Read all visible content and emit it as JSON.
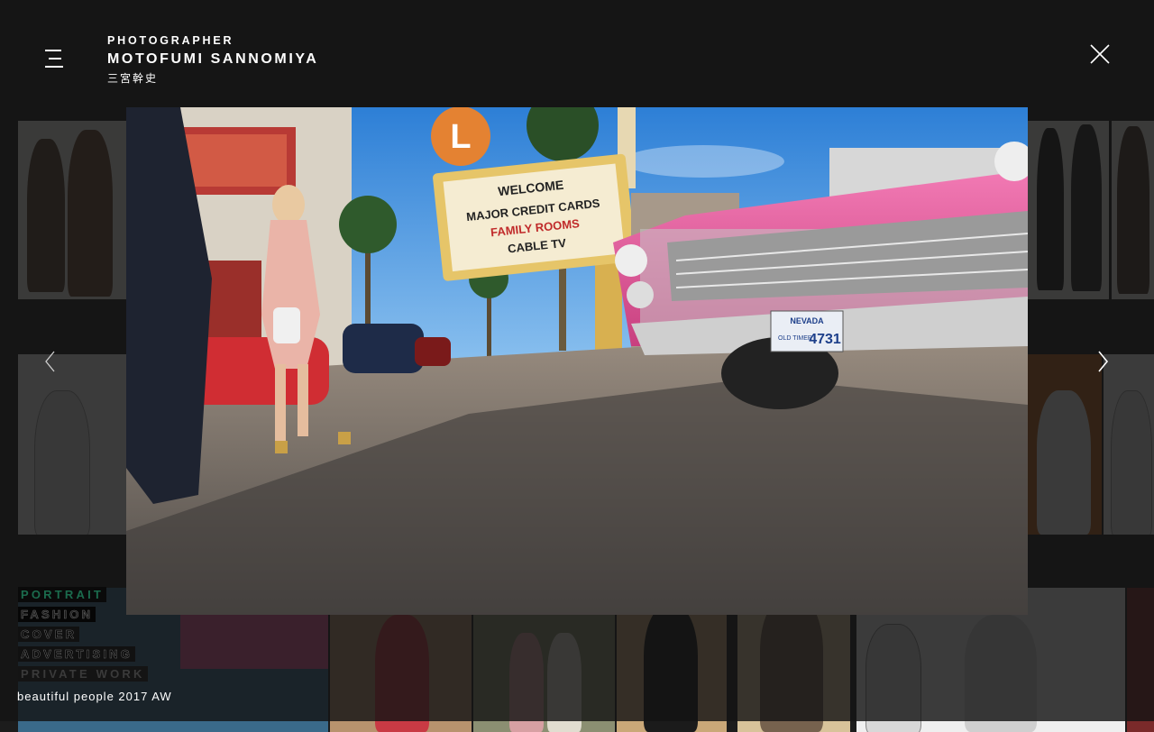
{
  "header": {
    "logo_line1": "PHOTOGRAPHER",
    "logo_line2": "MOTOFUMI SANNOMIYA",
    "logo_line3": "三宮幹史"
  },
  "icons": {
    "menu": "hamburger-menu-icon",
    "close": "close-icon",
    "prev": "chevron-left-icon",
    "next": "chevron-right-icon"
  },
  "lightbox": {
    "marquee_lines": [
      "WELCOME",
      "MAJOR CREDIT CARDS",
      "FAMILY ROOMS",
      "CABLE TV"
    ],
    "plate_state": "NEVADA",
    "plate_text": "OLD TIMER",
    "plate_number": "4731",
    "sign_letter": "L"
  },
  "categories": [
    {
      "label": "PORTRAIT"
    },
    {
      "label": "FASHION"
    },
    {
      "label": "COVER"
    },
    {
      "label": "ADVERTISING"
    },
    {
      "label": "PRIVATE WORK"
    }
  ],
  "caption": "beautiful people 2017 AW",
  "colors": {
    "background": "#1c1c1c",
    "portrait_accent": "#1b6b4d",
    "car_pink": "#e8559a",
    "sky": "#3d8fe0"
  }
}
